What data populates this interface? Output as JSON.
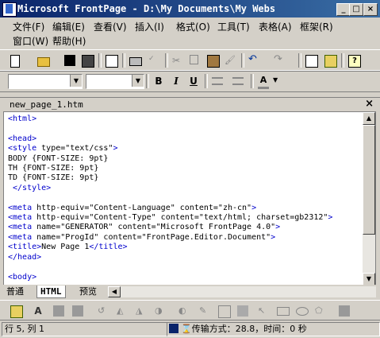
{
  "window": {
    "title": "Microsoft FrontPage - D:\\My Documents\\My Webs",
    "min": "_",
    "max": "□",
    "close": "×"
  },
  "menus": [
    "文件(F)",
    "编辑(E)",
    "查看(V)",
    "插入(I)",
    "格式(O)",
    "工具(T)",
    "表格(A)",
    "框架(R)",
    "窗口(W)",
    "帮助(H)"
  ],
  "document": {
    "tab_label": "new_page_1.htm",
    "close": "×"
  },
  "code_lines": [
    [
      [
        "tag",
        "<html>"
      ]
    ],
    [],
    [
      [
        "tag",
        "<head>"
      ]
    ],
    [
      [
        "tag",
        "<style "
      ],
      [
        "attr",
        "type="
      ],
      [
        "val",
        "\"text/css\""
      ],
      [
        "tag",
        ">"
      ]
    ],
    [
      [
        "val",
        "BODY {FONT-SIZE: 9pt}"
      ]
    ],
    [
      [
        "val",
        "TH {FONT-SIZE: 9pt}"
      ]
    ],
    [
      [
        "val",
        "TD {FONT-SIZE: 9pt}"
      ]
    ],
    [
      [
        "tag",
        " </style>"
      ]
    ],
    [],
    [
      [
        "tag",
        "<meta "
      ],
      [
        "attr",
        "http-equiv="
      ],
      [
        "val",
        "\"Content-Language\""
      ],
      [
        "attr",
        " content="
      ],
      [
        "val",
        "\"zh-cn\""
      ],
      [
        "tag",
        ">"
      ]
    ],
    [
      [
        "tag",
        "<meta "
      ],
      [
        "attr",
        "http-equiv="
      ],
      [
        "val",
        "\"Content-Type\""
      ],
      [
        "attr",
        " content="
      ],
      [
        "val",
        "\"text/html; charset=gb2312\""
      ],
      [
        "tag",
        ">"
      ]
    ],
    [
      [
        "tag",
        "<meta "
      ],
      [
        "attr",
        "name="
      ],
      [
        "val",
        "\"GENERATOR\""
      ],
      [
        "attr",
        " content="
      ],
      [
        "val",
        "\"Microsoft FrontPage 4.0\""
      ],
      [
        "tag",
        ">"
      ]
    ],
    [
      [
        "tag",
        "<meta "
      ],
      [
        "attr",
        "name="
      ],
      [
        "val",
        "\"ProgId\""
      ],
      [
        "attr",
        " content="
      ],
      [
        "val",
        "\"FrontPage.Editor.Document\""
      ],
      [
        "tag",
        ">"
      ]
    ],
    [
      [
        "tag",
        "<title>"
      ],
      [
        "val",
        "New Page 1"
      ],
      [
        "tag",
        "</title>"
      ]
    ],
    [
      [
        "tag",
        "</head>"
      ]
    ],
    [],
    [
      [
        "tag",
        "<body>"
      ]
    ]
  ],
  "view_tabs": [
    {
      "label": "普通",
      "active": false
    },
    {
      "label": "HTML",
      "active": true
    },
    {
      "label": "预览",
      "active": false
    }
  ],
  "status": {
    "position": "行 5, 列 1",
    "transfer": "传输方式：28.8，时间：0 秒"
  },
  "colors": {
    "tag": "#0000cc",
    "titlebar_start": "#0a246a",
    "titlebar_end": "#3a6ea5"
  }
}
